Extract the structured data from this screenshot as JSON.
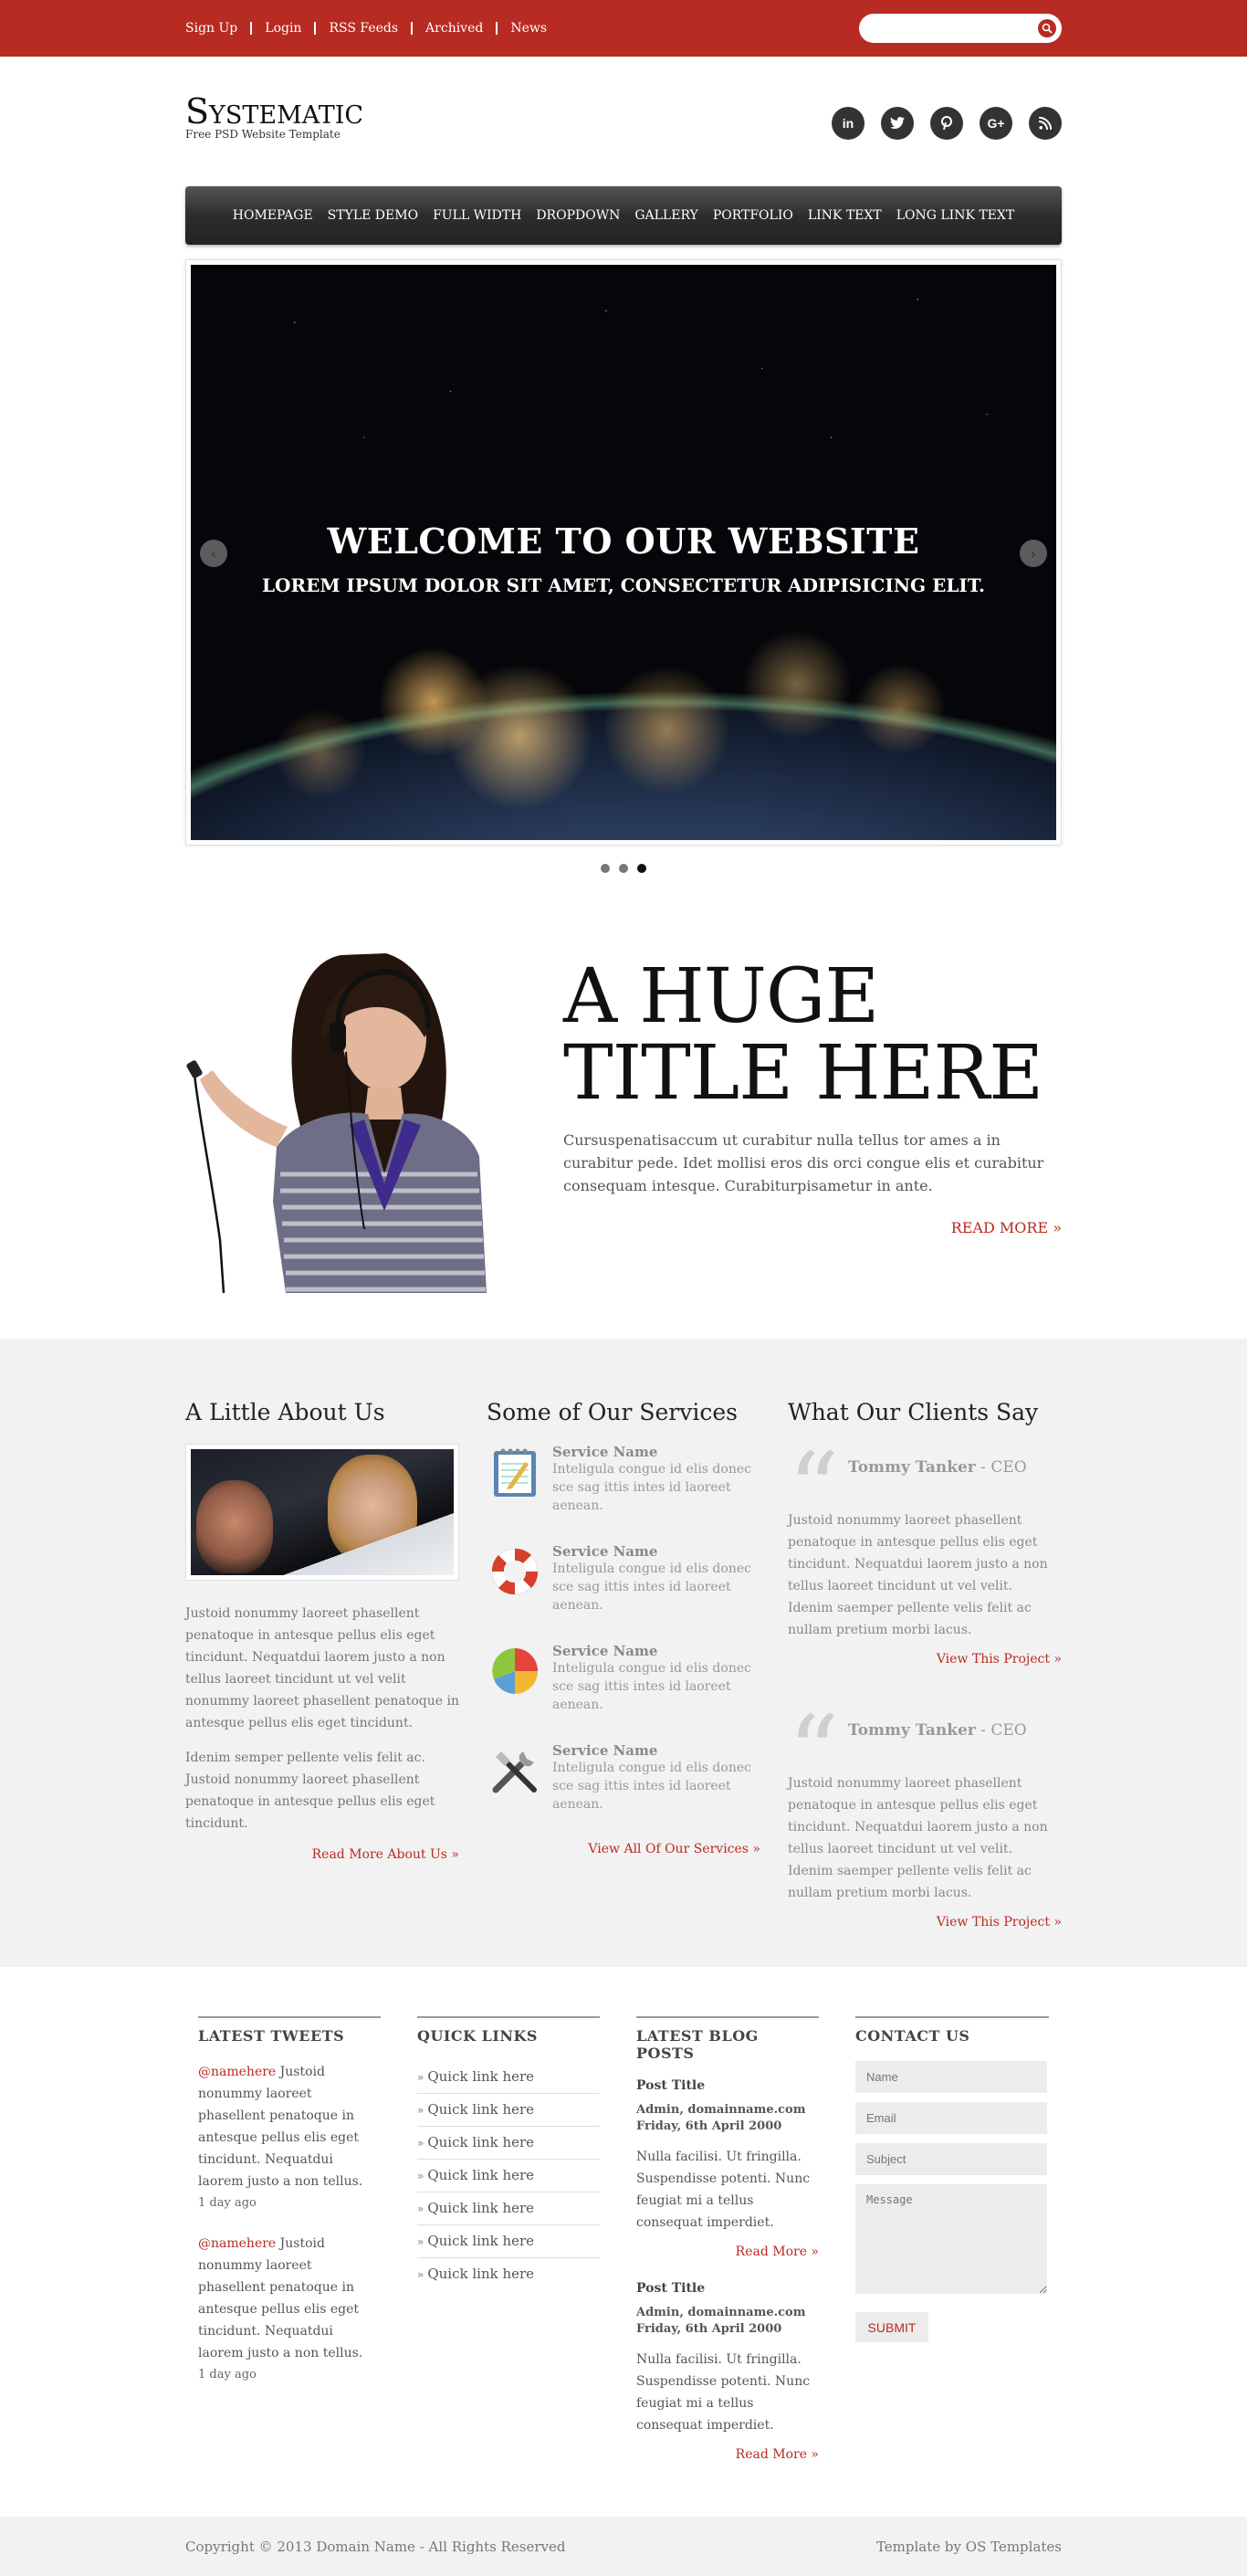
{
  "topbar": {
    "links": [
      "Sign Up",
      "Login",
      "RSS Feeds",
      "Archived",
      "News"
    ],
    "search_placeholder": ""
  },
  "header": {
    "logo": "Systematic",
    "tagline": "Free PSD Website Template",
    "socials": [
      "in",
      "t",
      "p",
      "G+",
      "rss"
    ]
  },
  "nav": {
    "items": [
      "Homepage",
      "Style Demo",
      "Full Width",
      "DropDown",
      "Gallery",
      "Portfolio",
      "Link Text",
      "Long Link Text"
    ]
  },
  "slider": {
    "title": "WELCOME TO OUR WEBSITE",
    "subtitle": "LOREM IPSUM DOLOR SIT AMET, CONSECTETUR ADIPISICING ELIT.",
    "prev": "‹",
    "next": "›",
    "dots": 3,
    "active_dot": 3
  },
  "feature": {
    "title_line1": "A HUGE",
    "title_line2": "TITLE HERE",
    "text": "Cursuspenatisaccum ut curabitur nulla tellus tor ames a in curabitur pede. Idet mollisi eros dis orci congue elis et curabitur consequam intesque. Curabiturpisametur in ante.",
    "read_more": "READ MORE »"
  },
  "about": {
    "heading": "A Little About Us",
    "p1": "Justoid nonummy laoreet phasellent penatoque in antesque pellus elis eget tincidunt. Nequatdui laorem justo a non tellus laoreet tincidunt ut vel velit nonummy laoreet phasellent penatoque in antesque pellus elis eget tincidunt.",
    "p2": "Idenim semper pellente velis felit ac. Justoid nonummy laoreet phasellent penatoque in antesque pellus elis eget tincidunt.",
    "link": "Read More About Us »"
  },
  "services": {
    "heading": "Some of Our Services",
    "items": [
      {
        "title": "Service Name",
        "desc": "Inteligula congue id elis donec sce sag ittis intes id laoreet aenean."
      },
      {
        "title": "Service Name",
        "desc": "Inteligula congue id elis donec sce sag ittis intes id laoreet aenean."
      },
      {
        "title": "Service Name",
        "desc": "Inteligula congue id elis donec sce sag ittis intes id laoreet aenean."
      },
      {
        "title": "Service Name",
        "desc": "Inteligula congue id elis donec sce sag ittis intes id laoreet aenean."
      }
    ],
    "link": "View All Of Our Services »"
  },
  "clients": {
    "heading": "What Our Clients Say",
    "quotes": [
      {
        "name": "Tommy Tanker",
        "role": " - CEO",
        "text": "Justoid nonummy laoreet phasellent penatoque in antesque pellus elis eget tincidunt. Nequatdui laorem justo a non tellus laoreet tincidunt ut vel velit. Idenim saemper pellente velis felit ac nullam pretium morbi lacus.",
        "link": "View This Project »"
      },
      {
        "name": "Tommy Tanker",
        "role": " - CEO",
        "text": "Justoid nonummy laoreet phasellent penatoque in antesque pellus elis eget tincidunt. Nequatdui laorem justo a non tellus laoreet tincidunt ut vel velit. Idenim saemper pellente velis felit ac nullam pretium morbi lacus.",
        "link": "View This Project »"
      }
    ]
  },
  "footer": {
    "tweets_heading": "Latest Tweets",
    "tweets": [
      {
        "handle": "@namehere",
        "text": " Justoid nonummy laoreet phasellent penatoque in antesque pellus elis eget tincidunt. Nequatdui laorem justo a non tellus.",
        "ago": "1 day ago"
      },
      {
        "handle": "@namehere",
        "text": " Justoid nonummy laoreet phasellent penatoque in antesque pellus elis eget tincidunt. Nequatdui laorem justo a non tellus.",
        "ago": "1 day ago"
      }
    ],
    "links_heading": "Quick Links",
    "links": [
      "Quick link here",
      "Quick link here",
      "Quick link here",
      "Quick link here",
      "Quick link here",
      "Quick link here",
      "Quick link here"
    ],
    "blog_heading": "Latest Blog Posts",
    "posts": [
      {
        "title": "Post Title",
        "author": "Admin, domainname.com",
        "date": "Friday, 6th April 2000",
        "text": "Nulla facilisi. Ut fringilla. Suspendisse potenti. Nunc feugiat mi a tellus consequat imperdiet.",
        "link": "Read More »"
      },
      {
        "title": "Post Title",
        "author": "Admin, domainname.com",
        "date": "Friday, 6th April 2000",
        "text": "Nulla facilisi. Ut fringilla. Suspendisse potenti. Nunc feugiat mi a tellus consequat imperdiet.",
        "link": "Read More »"
      }
    ],
    "contact_heading": "Contact Us",
    "form": {
      "name": "Name",
      "email": "Email",
      "subject": "Subject",
      "message": "Message",
      "submit": "SUBMIT"
    }
  },
  "bottom": {
    "copyright": "Copyright © 2013 Domain Name - All Rights Reserved",
    "credit": "Template by OS Templates"
  },
  "colors": {
    "accent": "#b82b22",
    "grey_bg": "#f2f2f2",
    "dark": "#333333"
  }
}
